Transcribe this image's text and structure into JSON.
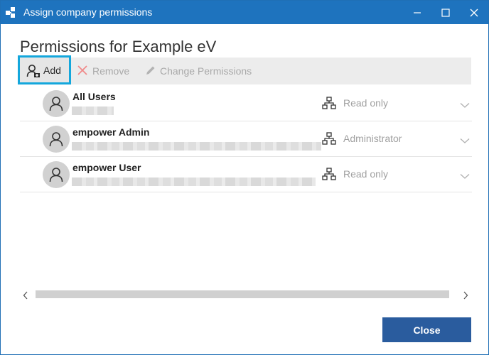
{
  "window": {
    "title": "Assign company permissions",
    "title_color": "#1e73be"
  },
  "heading": "Permissions for Example eV",
  "toolbar": {
    "add_label": "Add",
    "remove_label": "Remove",
    "change_label": "Change Permissions",
    "add_icon": "add-user-icon",
    "remove_icon": "x-icon",
    "change_icon": "pencil-icon"
  },
  "users": [
    {
      "name": "All Users",
      "permission": "Read only"
    },
    {
      "name": "empower Admin",
      "permission": "Administrator"
    },
    {
      "name": "empower User",
      "permission": "Read only"
    }
  ],
  "footer": {
    "close_label": "Close",
    "close_color": "#2a5c9e"
  },
  "colors": {
    "highlight_outline": "#14a7dc"
  }
}
